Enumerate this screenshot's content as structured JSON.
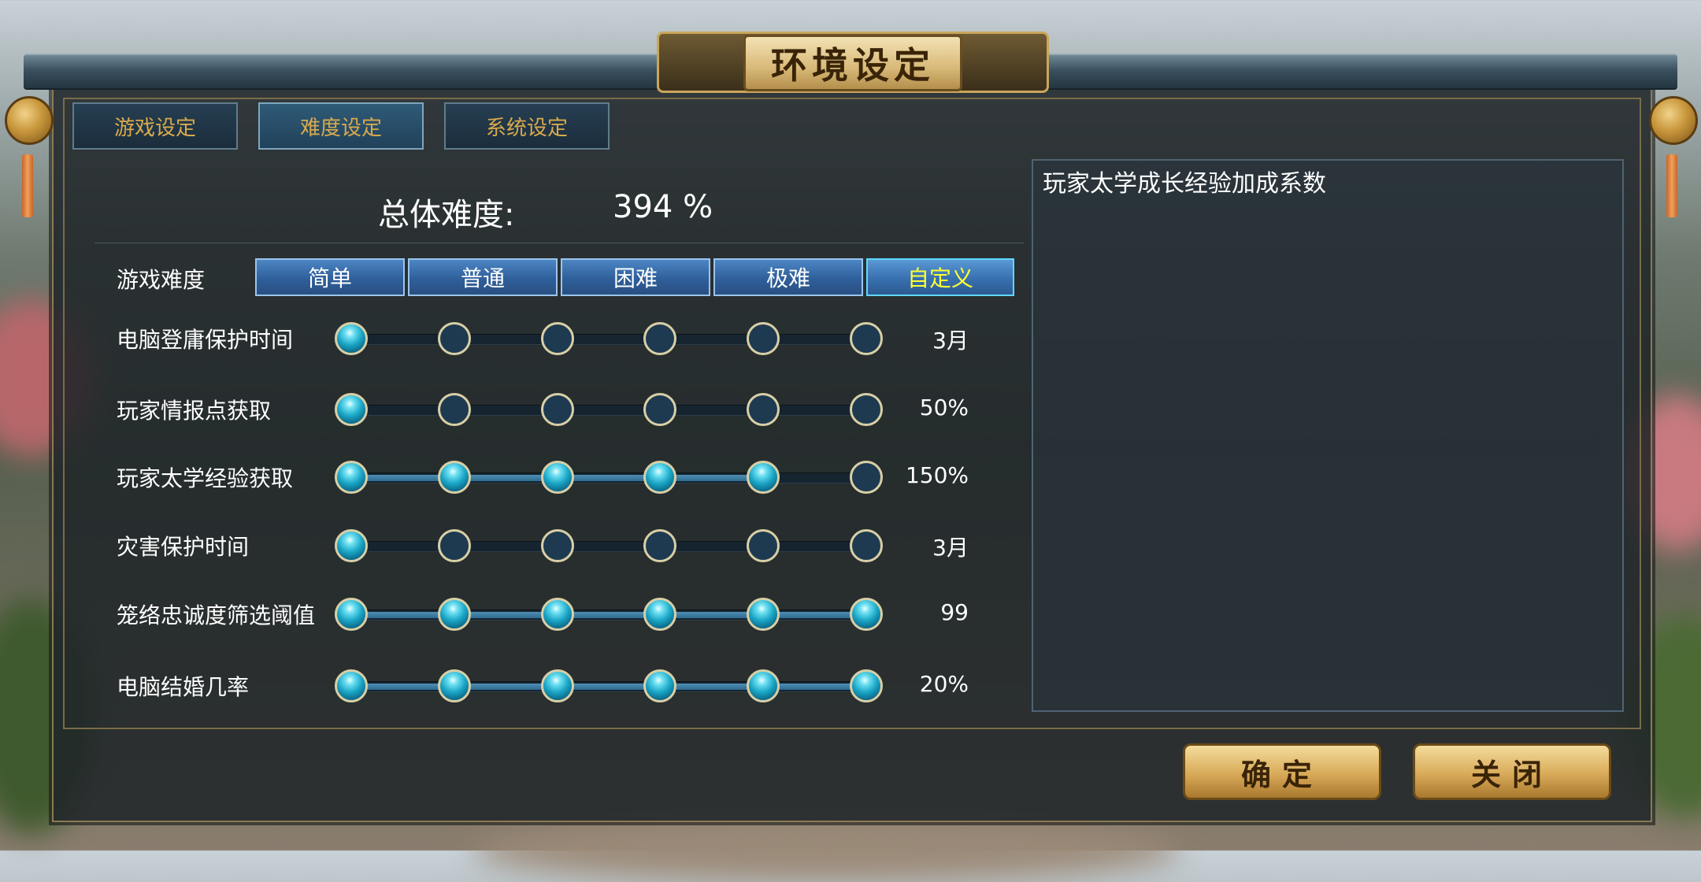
{
  "window": {
    "title": "环境设定"
  },
  "tabs": [
    {
      "label": "游戏设定",
      "active": false
    },
    {
      "label": "难度设定",
      "active": true
    },
    {
      "label": "系统设定",
      "active": false
    }
  ],
  "total": {
    "label": "总体难度:",
    "value": "394 %"
  },
  "difficulty": {
    "label": "游戏难度",
    "options": [
      "简单",
      "普通",
      "困难",
      "极难",
      "自定义"
    ],
    "selected": "自定义"
  },
  "settings": [
    {
      "label": "电脑登庸保护时间",
      "value": "3月",
      "level": 1,
      "steps": 6
    },
    {
      "label": "玩家情报点获取",
      "value": "50%",
      "level": 1,
      "steps": 6
    },
    {
      "label": "玩家太学经验获取",
      "value": "150%",
      "level": 5,
      "steps": 6
    },
    {
      "label": "灾害保护时间",
      "value": "3月",
      "level": 1,
      "steps": 6
    },
    {
      "label": "笼络忠诚度筛选阈值",
      "value": "99",
      "level": 6,
      "steps": 6
    },
    {
      "label": "电脑结婚几率",
      "value": "20%",
      "level": 6,
      "steps": 6
    }
  ],
  "description": {
    "text": "玩家太学成长经验加成系数"
  },
  "buttons": {
    "confirm": "确定",
    "close": "关闭"
  },
  "colors": {
    "selected_option_text": "#ffff33",
    "tab_text": "#d9aa4c",
    "knob_on": "#1aa6c6"
  }
}
